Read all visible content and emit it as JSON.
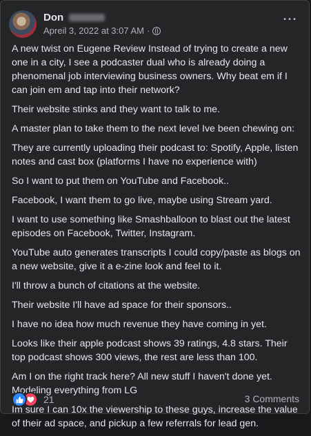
{
  "post": {
    "author": "Don",
    "timestamp": "Apreil 3, 2022 at 3:07 AM",
    "separator": "·",
    "audience_icon": "globe-icon",
    "more_icon": "···",
    "paragraphs": [
      "A new twist on Eugene Review Instead of trying to create a new one in a city, I see a podcaster dual who is already doing a phenomenal job interviewing business owners.  Why beat em if I can join em and tap into their network?",
      "Their website stinks and they want to talk to me.",
      "A master plan to take them to the next level Ive been chewing on:",
      "They are currently uploading their podcast to: Spotify, Apple,  listen notes and cast box (platforms I have no experience with)",
      "So I want to put them on YouTube and Facebook..",
      "Facebook, I want them to go live, maybe using Stream yard.",
      "I want to use something like Smashballoon to blast out the latest episodes on Facebook, Twitter, Instagram.",
      "YouTube auto generates transcripts I could copy/paste as blogs on a new website, give it a e-zine look and feel to it.",
      "I'll throw a bunch of citations at the website.",
      "Their website I'll have ad space for their sponsors..",
      "I have no idea how much revenue they have coming in yet.",
      "Looks like their apple podcast shows 39 ratings, 4.8 stars.  Their top podcast shows 300 views, the rest are less than 100.",
      "Am I on the right track here?  All new stuff I haven't done yet.  Modeling everything from LG",
      "Im sure I can 10x the viewership to these guys, increase the value of their ad space, and pickup a few referrals for lead gen."
    ]
  },
  "footer": {
    "reaction_icons": [
      "like-icon",
      "love-icon"
    ],
    "reaction_count": "21",
    "comments": "3 Comments"
  },
  "colors": {
    "card_bg": "#242526",
    "text_primary": "#e4e6eb",
    "text_secondary": "#b0b3b8",
    "like_blue": "#2d88ff",
    "love_red": "#f3425f"
  }
}
